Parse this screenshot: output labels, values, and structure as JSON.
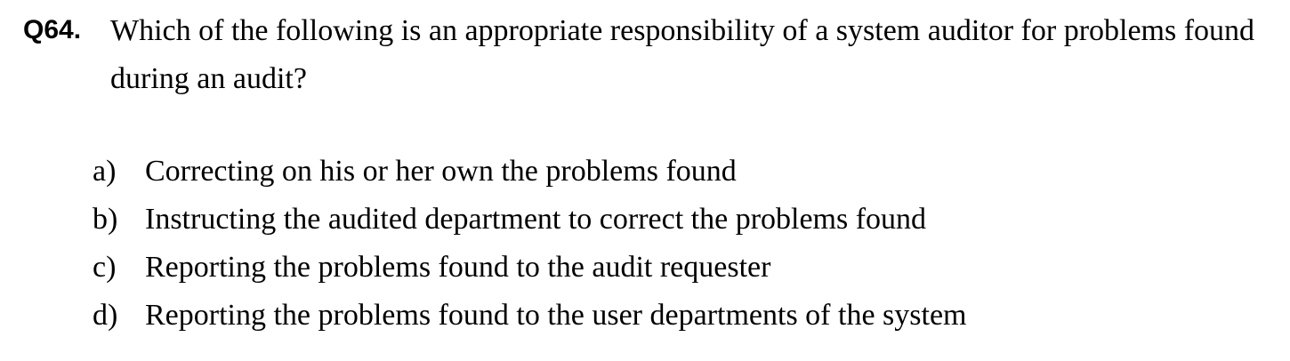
{
  "question": {
    "number": "Q64.",
    "text": "Which of the following is an appropriate responsibility of a system auditor for problems found during an audit?"
  },
  "options": [
    {
      "letter": "a)",
      "text": "Correcting on his or her own the problems found"
    },
    {
      "letter": "b)",
      "text": "Instructing the audited department to correct the problems found"
    },
    {
      "letter": "c)",
      "text": "Reporting the problems found to the audit requester"
    },
    {
      "letter": "d)",
      "text": "Reporting the problems found to the user departments of the system"
    }
  ]
}
